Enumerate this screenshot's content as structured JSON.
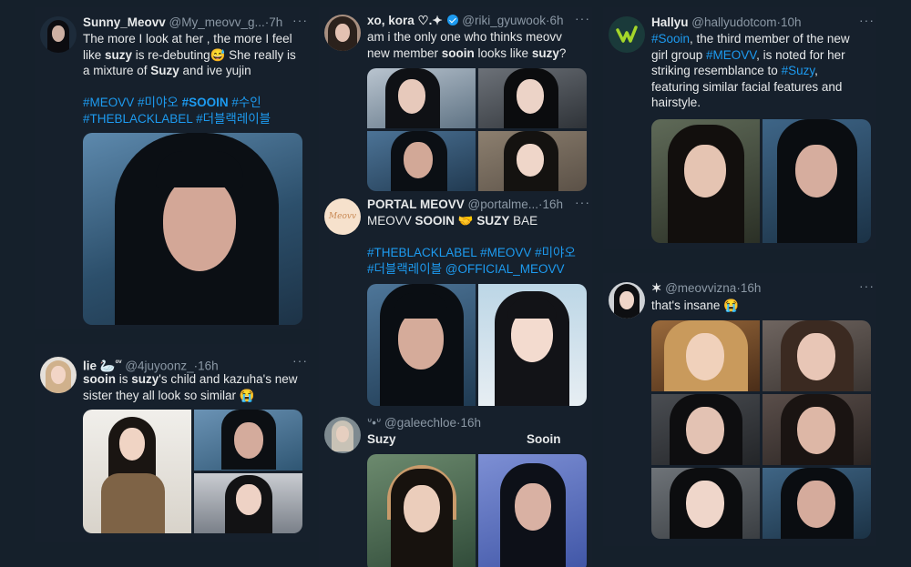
{
  "more_glyph": "···",
  "t1": {
    "name": "Sunny_Meovv",
    "handle": "@My_meovv_g...",
    "sep": "·",
    "time": "7h",
    "l1": "The more I look at her , the more I feel",
    "l2a": "like ",
    "l2b": "suzy",
    "l2c": " is re-debuting",
    "l2emoji": "😅",
    "l2d": " She really is",
    "l3a": "a mixture of ",
    "l3b": "Suzy",
    "l3c": " and ive yujin",
    "h1": "#MEOVV",
    "h2": "#미야오",
    "h3": "#SOOIN",
    "h4": "#수인",
    "h5": "#THEBLACKLABEL",
    "h6": "#더블랙레이블"
  },
  "t2": {
    "name": "lie",
    "name_emoji": "🦢",
    "name_sup": "ᵒᵛ",
    "handle": "@4juyoonz_",
    "sep": "·",
    "time": "16h",
    "l1a": "sooin",
    "l1b": " is ",
    "l1c": "suzy",
    "l1d": "'s child and kazuha's new",
    "l2": "sister they all look so similar",
    "l2emoji": "😭"
  },
  "t3": {
    "name": "xo, kora",
    "name_deco": "♡.✦",
    "handle": "@riki_gyuwook",
    "sep": "·",
    "time": "6h",
    "l1": "am i the only one who thinks meovv",
    "l2a": "new member ",
    "l2b": "sooin",
    "l2c": " looks like ",
    "l2d": "suzy",
    "l2e": "?"
  },
  "t4": {
    "name": "PORTAL MEOVV",
    "handle": "@portalme...",
    "sep": "·",
    "time": "16h",
    "avatar_text": "Meovv",
    "l1a": "MEOVV ",
    "l1b": "SOOIN",
    "l1emoji": "🤝",
    "l1c": "SUZY",
    "l1d": " BAE",
    "h1": "#THEBLACKLABEL",
    "h2": "#MEOVV",
    "h3": "#미야오",
    "h4": "#더블랙레이블",
    "h5": "@OFFICIAL_MEOVV"
  },
  "t5": {
    "name_deco": "ᐡ•ᐡ",
    "handle": "@galeechloe",
    "sep": "·",
    "time": "16h",
    "label_left": "Suzy",
    "label_right": "Sooin"
  },
  "t6": {
    "name": "Hallyu",
    "handle": "@hallyudotcom",
    "sep": "·",
    "time": "10h",
    "l1a": "#Sooin",
    "l1b": ", the third member of the new",
    "l2a": "girl group ",
    "l2b": "#MEOVV",
    "l2c": ", is noted for her",
    "l3a": "striking resemblance to ",
    "l3b": "#Suzy",
    "l3c": ",",
    "l4": "featuring similar facial features and",
    "l5": "hairstyle."
  },
  "t7": {
    "name": "✶",
    "handle": "@meovvizna",
    "sep": "·",
    "time": "16h",
    "l1": "that's insane",
    "l1emoji": "😭"
  },
  "colors": {
    "background": "#15202b",
    "link": "#1d9bf0",
    "muted": "#8b98a5",
    "hallyu_logo": "#a4d62a"
  }
}
